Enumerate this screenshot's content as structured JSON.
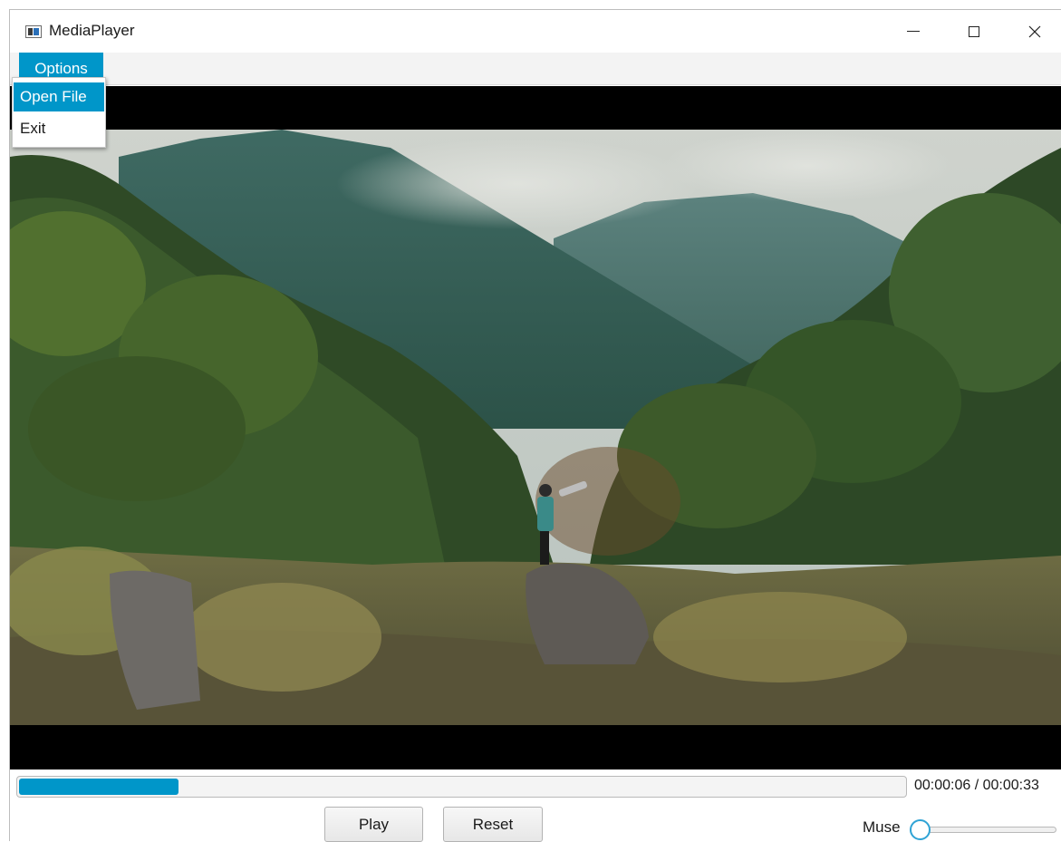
{
  "window": {
    "title": "MediaPlayer",
    "controls": {
      "minimize": "—",
      "maximize": "☐",
      "close": "✕"
    }
  },
  "menu": {
    "options_label": "Options",
    "items": [
      {
        "label": "Open File",
        "highlighted": true
      },
      {
        "label": "Exit",
        "highlighted": false
      }
    ]
  },
  "video": {
    "scene": "mountain-forest"
  },
  "playback": {
    "current_time": "00:00:06",
    "separator": "/",
    "total_time": "00:00:33",
    "time_display": "00:00:06 / 00:00:33",
    "progress_fraction": 0.18
  },
  "buttons": {
    "play": "Play",
    "reset": "Reset"
  },
  "volume": {
    "label": "Muse",
    "value": 0
  },
  "colors": {
    "accent": "#0096c9",
    "thumb_border": "#2fa3d5"
  },
  "icons": {
    "app": "app-window-icon",
    "minimize": "minimize-icon",
    "maximize": "maximize-icon",
    "close": "close-icon"
  }
}
